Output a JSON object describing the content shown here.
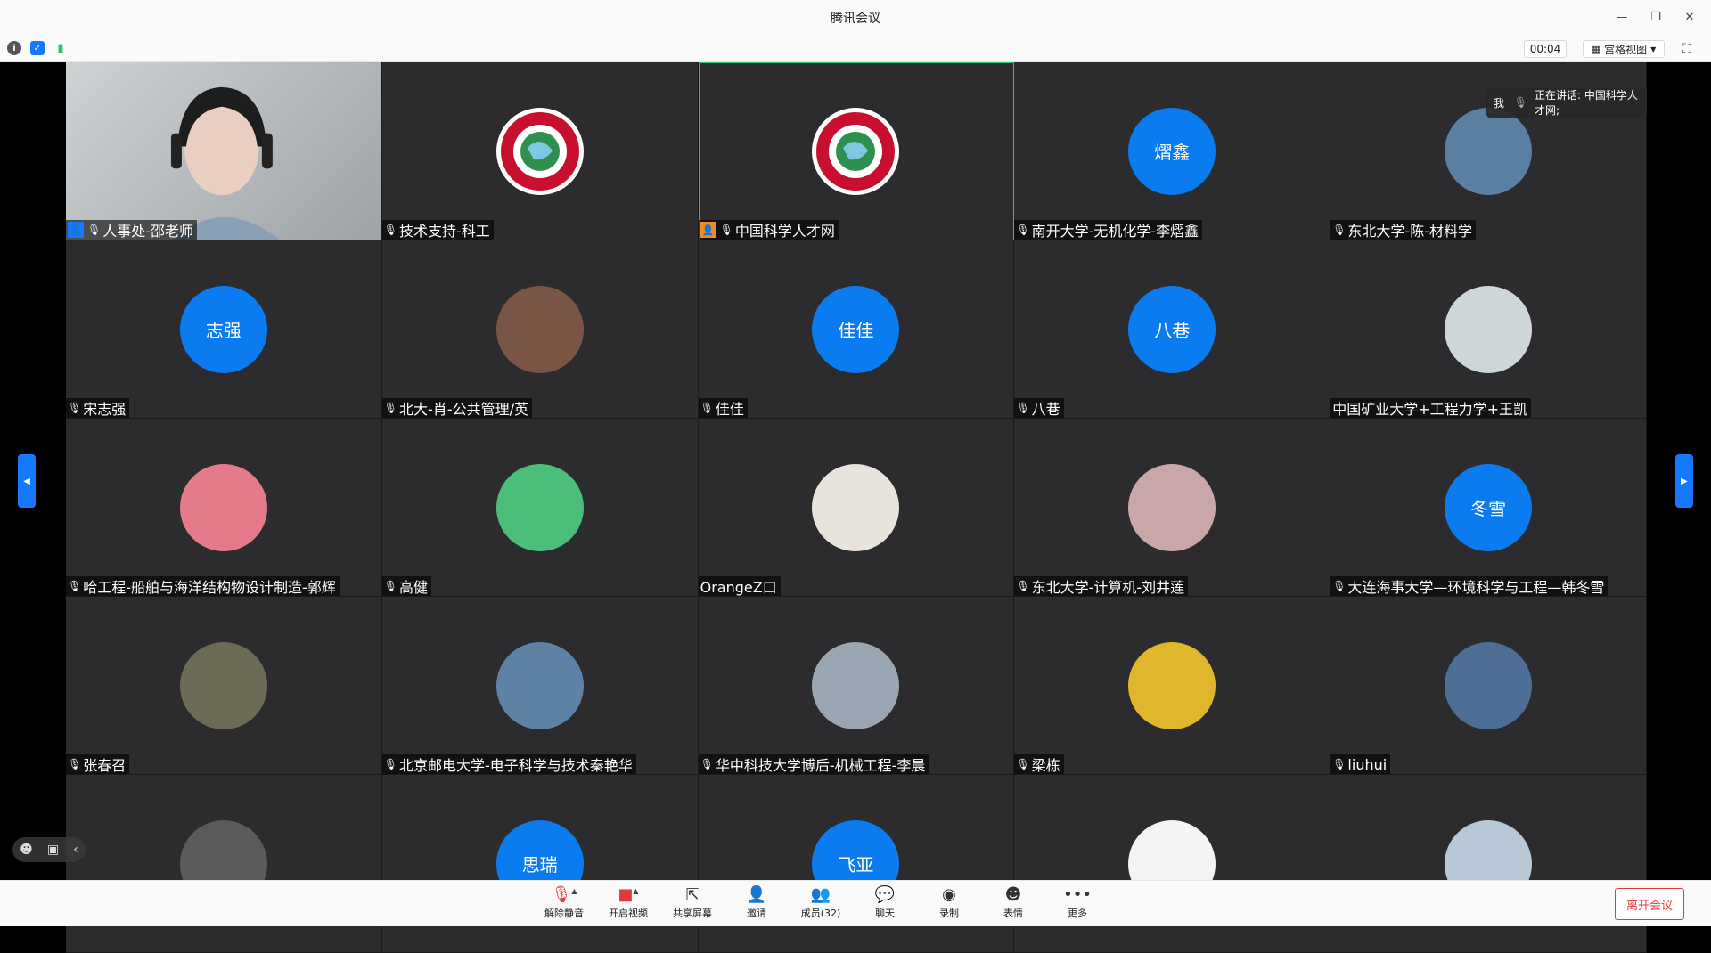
{
  "window": {
    "title": "腾讯会议"
  },
  "infobar": {
    "timer": "00:04",
    "view_label": "宫格视图"
  },
  "speaker_popup": {
    "me": "我",
    "text": "正在讲话: 中国科学人才网;"
  },
  "tiles": [
    {
      "name": "人事处-邵老师",
      "type": "video",
      "host": "blue"
    },
    {
      "name": "技术支持-科工",
      "type": "logo"
    },
    {
      "name": "中国科学人才网",
      "type": "logo",
      "host": "orange",
      "speaking": true
    },
    {
      "name": "南开大学-无机化学-李熠鑫",
      "type": "text",
      "initials": "熠鑫"
    },
    {
      "name": "东北大学-陈-材料学",
      "type": "photo",
      "color": "#5b7fa3"
    },
    {
      "name": "宋志强",
      "type": "text",
      "initials": "志强"
    },
    {
      "name": "北大-肖-公共管理/英",
      "type": "photo",
      "color": "#7a5546"
    },
    {
      "name": "佳佳",
      "type": "text",
      "initials": "佳佳"
    },
    {
      "name": "八巷",
      "type": "text",
      "initials": "八巷"
    },
    {
      "name": "中国矿业大学+工程力学+王凯",
      "type": "photo",
      "color": "#cfd6d8",
      "nomic": true
    },
    {
      "name": "哈工程-船舶与海洋结构物设计制造-郭辉",
      "type": "photo",
      "color": "#e47a8a"
    },
    {
      "name": "高健",
      "type": "photo",
      "color": "#4bbf7a"
    },
    {
      "name": "OrangeZ口",
      "type": "photo",
      "color": "#e8e3dc",
      "nomic": true
    },
    {
      "name": "东北大学-计算机-刘井莲",
      "type": "photo",
      "color": "#c9a7a8"
    },
    {
      "name": "大连海事大学—环境科学与工程—韩冬雪",
      "type": "text",
      "initials": "冬雪"
    },
    {
      "name": "张春召",
      "type": "photo",
      "color": "#6c6b55"
    },
    {
      "name": "北京邮电大学-电子科学与技术秦艳华",
      "type": "photo",
      "color": "#5e82a6"
    },
    {
      "name": "华中科技大学博后-机械工程-李晨",
      "type": "photo",
      "color": "#9aa6b1"
    },
    {
      "name": "梁栋",
      "type": "photo",
      "color": "#e0b62a"
    },
    {
      "name": "liuhui",
      "type": "photo",
      "color": "#4d6f96"
    },
    {
      "name": "",
      "type": "photo",
      "color": "#5a5a5a"
    },
    {
      "name": "",
      "type": "text",
      "initials": "思瑞"
    },
    {
      "name": "",
      "type": "text",
      "initials": "飞亚"
    },
    {
      "name": "",
      "type": "photo",
      "color": "#f4f4f4"
    },
    {
      "name": "",
      "type": "photo",
      "color": "#b8c8d6"
    }
  ],
  "toolbar": {
    "unmute": "解除静音",
    "video": "开启视频",
    "share": "共享屏幕",
    "invite": "邀请",
    "members": "成员(32)",
    "chat": "聊天",
    "record": "录制",
    "emoji": "表情",
    "more": "更多",
    "leave": "离开会议"
  },
  "colors": {
    "accent": "#1677ff",
    "danger": "#e03b3b",
    "tile_bg": "#2c2c2e"
  }
}
